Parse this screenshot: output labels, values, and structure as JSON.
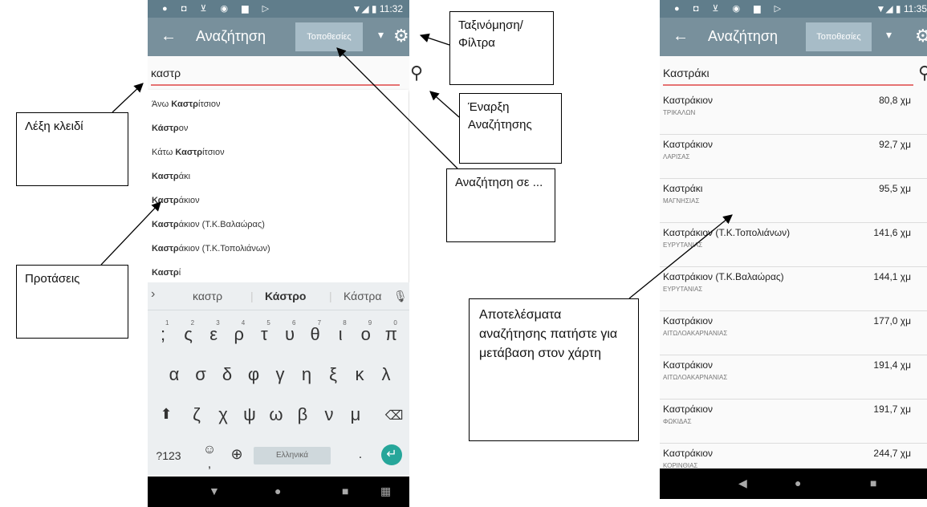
{
  "left_phone": {
    "status_icons": "● ◘ ⊻ ◉ ▆ ▷",
    "status_time": "11:32",
    "appbar": {
      "back_icon": "arrow-back-icon",
      "title": "Αναζήτηση",
      "spinner_label": "Τοποθεσίες",
      "caret_icon": "caret-down-icon",
      "gear_icon": "gear-icon"
    },
    "search": {
      "query": "καστρ",
      "search_icon": "search-icon"
    },
    "suggestions": [
      {
        "pre": "Άνω ",
        "bold": "Καστρ",
        "post": "ίτσιον"
      },
      {
        "pre": "",
        "bold": "Κάστρ",
        "post": "ον"
      },
      {
        "pre": "Κάτω ",
        "bold": "Καστρ",
        "post": "ίτσιον"
      },
      {
        "pre": "",
        "bold": "Καστρ",
        "post": "άκι"
      },
      {
        "pre": "",
        "bold": "Καστρ",
        "post": "άκιον"
      },
      {
        "pre": "",
        "bold": "Καστρ",
        "post": "άκιον (Τ.Κ.Βαλαώρας)"
      },
      {
        "pre": "",
        "bold": "Καστρ",
        "post": "άκιον (Τ.Κ.Τοπολιάνων)"
      },
      {
        "pre": "",
        "bold": "Καστρ",
        "post": "ί"
      }
    ],
    "keyboard": {
      "suggestion_words": [
        "καστρ",
        "Κάστρο",
        "Κάστρα"
      ],
      "row1": [
        ";",
        "ς",
        "ε",
        "ρ",
        "τ",
        "υ",
        "θ",
        "ι",
        "ο",
        "π"
      ],
      "row1_hints": [
        "1",
        "2",
        "3",
        "4",
        "5",
        "6",
        "7",
        "8",
        "9",
        "0"
      ],
      "row2": [
        "α",
        "σ",
        "δ",
        "φ",
        "γ",
        "η",
        "ξ",
        "κ",
        "λ"
      ],
      "row3": [
        "ζ",
        "χ",
        "ψ",
        "ω",
        "β",
        "ν",
        "μ"
      ],
      "symbols_key": "?123",
      "space_label": "Ελληνικά",
      "period_key": "."
    }
  },
  "right_phone": {
    "status_icons": "● ◘ ⊻ ◉ ▆ ▷",
    "status_time": "11:35",
    "appbar": {
      "title": "Αναζήτηση",
      "spinner_label": "Τοποθεσίες"
    },
    "search": {
      "query": "Καστράκι"
    },
    "results": [
      {
        "name": "Καστράκιον",
        "prefecture": "ΤΡΙΚΑΛΩΝ",
        "distance": "80,8 χμ"
      },
      {
        "name": "Καστράκιον",
        "prefecture": "ΛΑΡΙΣΑΣ",
        "distance": "92,7 χμ"
      },
      {
        "name": "Καστράκι",
        "prefecture": "ΜΑΓΝΗΣΙΑΣ",
        "distance": "95,5 χμ"
      },
      {
        "name": "Καστράκιον (Τ.Κ.Τοπολιάνων)",
        "prefecture": "ΕΥΡΥΤΑΝΙΑΣ",
        "distance": "141,6 χμ"
      },
      {
        "name": "Καστράκιον (Τ.Κ.Βαλαώρας)",
        "prefecture": "ΕΥΡΥΤΑΝΙΑΣ",
        "distance": "144,1 χμ"
      },
      {
        "name": "Καστράκιον",
        "prefecture": "ΑΙΤΩΛΟΑΚΑΡΝΑΝΙΑΣ",
        "distance": "177,0 χμ"
      },
      {
        "name": "Καστράκιον",
        "prefecture": "ΑΙΤΩΛΟΑΚΑΡΝΑΝΙΑΣ",
        "distance": "191,4 χμ"
      },
      {
        "name": "Καστράκιον",
        "prefecture": "ΦΩΚΙΔΑΣ",
        "distance": "191,7 χμ"
      },
      {
        "name": "Καστράκιον",
        "prefecture": "ΚΟΡΙΝΘΙΑΣ",
        "distance": "244,7 χμ"
      }
    ]
  },
  "callouts": {
    "keyword": "Λέξη κλειδί",
    "sort_filter": "Ταξινόμηση/ Φίλτρα",
    "start_search": "Έναρξη Αναζήτησης",
    "search_in": "Αναζήτηση σε ...",
    "suggestions": "Προτάσεις",
    "results": "Αποτελέσματα αναζήτησης πατήστε για μετάβαση στον χάρτη"
  },
  "colors": {
    "statusbar": "#607d8b",
    "appbar": "#78909c",
    "spinner": "#a7bcc7",
    "underline": "#e57373",
    "enter_key": "#26a69a"
  }
}
